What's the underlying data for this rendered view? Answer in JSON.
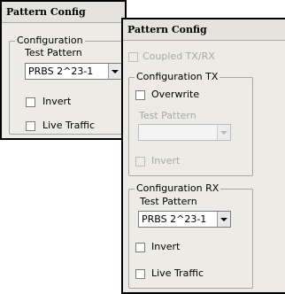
{
  "back_panel": {
    "title": "Pattern Config",
    "group_title": "Configuration",
    "test_pattern_label": "Test Pattern",
    "test_pattern_value": "PRBS 2^23-1",
    "invert_label": "Invert",
    "live_traffic_label": "Live Traffic"
  },
  "front_panel": {
    "title": "Pattern Config",
    "coupled_label": "Coupled TX/RX",
    "tx": {
      "group_title": "Configuration TX",
      "overwrite_label": "Overwrite",
      "test_pattern_label": "Test Pattern",
      "test_pattern_value": "",
      "invert_label": "Invert"
    },
    "rx": {
      "group_title": "Configuration RX",
      "test_pattern_label": "Test Pattern",
      "test_pattern_value": "PRBS 2^23-1",
      "invert_label": "Invert",
      "live_traffic_label": "Live Traffic"
    }
  }
}
